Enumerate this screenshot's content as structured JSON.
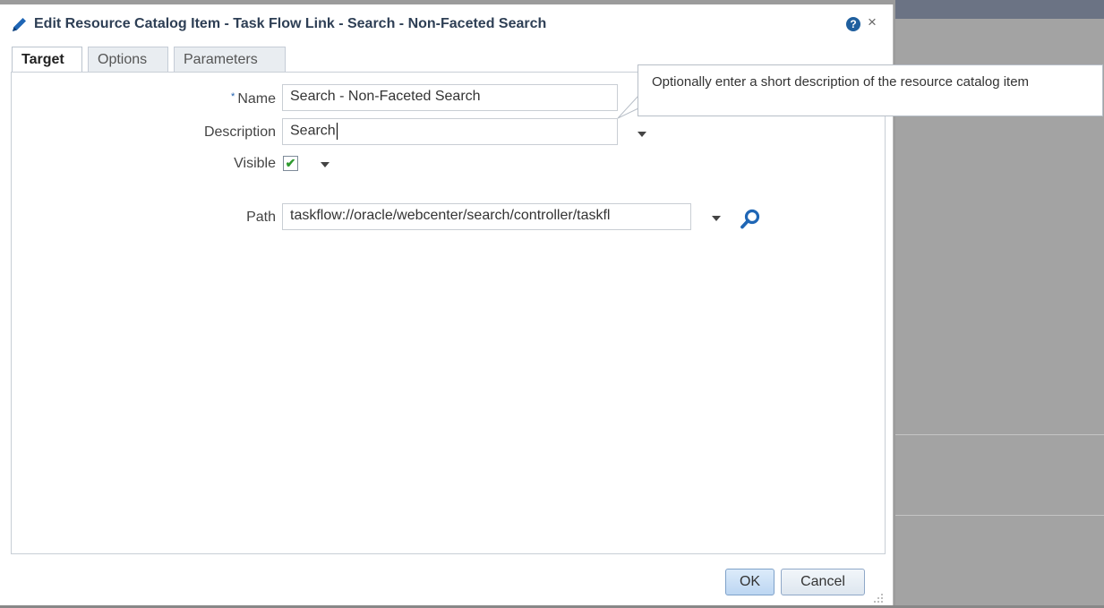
{
  "dialog": {
    "title": "Edit Resource Catalog Item - Task Flow Link - Search - Non-Faceted Search",
    "help_glyph": "?",
    "close_glyph": "×"
  },
  "tabs": [
    {
      "label": "Target",
      "active": true
    },
    {
      "label": "Options",
      "active": false
    },
    {
      "label": "Parameters",
      "active": false
    }
  ],
  "form": {
    "required_marker": "*",
    "name_label": "Name",
    "name_value": "Search - Non-Faceted Search",
    "description_label": "Description",
    "description_value": "Search",
    "visible_label": "Visible",
    "visible_checked": true,
    "checkmark_glyph": "✔",
    "path_label": "Path",
    "path_value": "taskflow://oracle/webcenter/search/controller/taskfl"
  },
  "tooltip": {
    "text": "Optionally enter a short description of the resource catalog item"
  },
  "footer": {
    "ok_label": "OK",
    "cancel_label": "Cancel"
  },
  "icons": {
    "title": "pencil-icon",
    "help": "help-icon",
    "close": "close-icon",
    "search": "magnifier-icon"
  },
  "colors": {
    "title_text": "#2e3f55",
    "accent_blue": "#1f66b5",
    "check_green": "#2e9a2e"
  }
}
